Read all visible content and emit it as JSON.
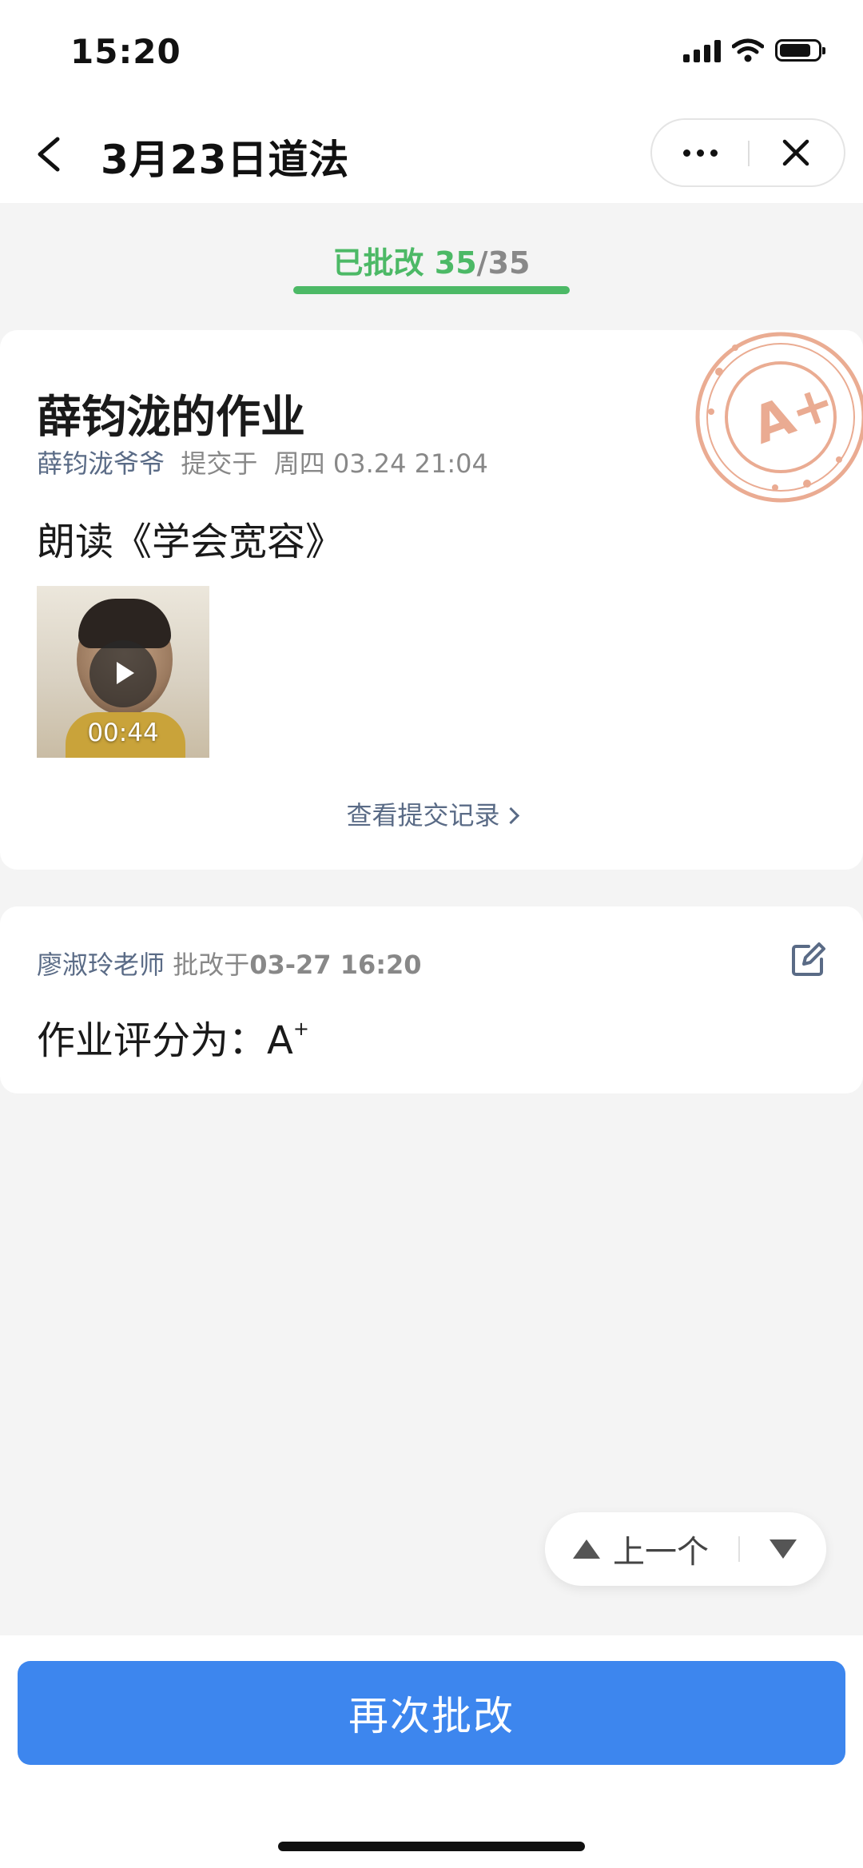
{
  "status_bar": {
    "time": "15:20"
  },
  "nav": {
    "title": "3月23日道法"
  },
  "tab": {
    "label": "已批改 ",
    "done": "35",
    "sep": "/",
    "total": "35"
  },
  "submission": {
    "title": "薛钧泷的作业",
    "submitter": "薛钧泷爷爷",
    "submitted_text": "  提交于  周四 03.24 21:04",
    "task": "朗读《学会宽容》",
    "video_duration": "00:44",
    "records_link": "查看提交记录",
    "stamp": "A+"
  },
  "review": {
    "teacher": "廖淑玲老师",
    "reviewed_label": " 批改于",
    "reviewed_time": "03-27 16:20",
    "grade_label": "作业评分为：",
    "grade": "A",
    "grade_sup": "+"
  },
  "pager": {
    "prev_label": "上一个"
  },
  "action_button": "再次批改",
  "colors": {
    "accent_green": "#4cb966",
    "primary_blue": "#3d86ee",
    "stamp": "#e8a387",
    "link": "#5a6b86"
  }
}
